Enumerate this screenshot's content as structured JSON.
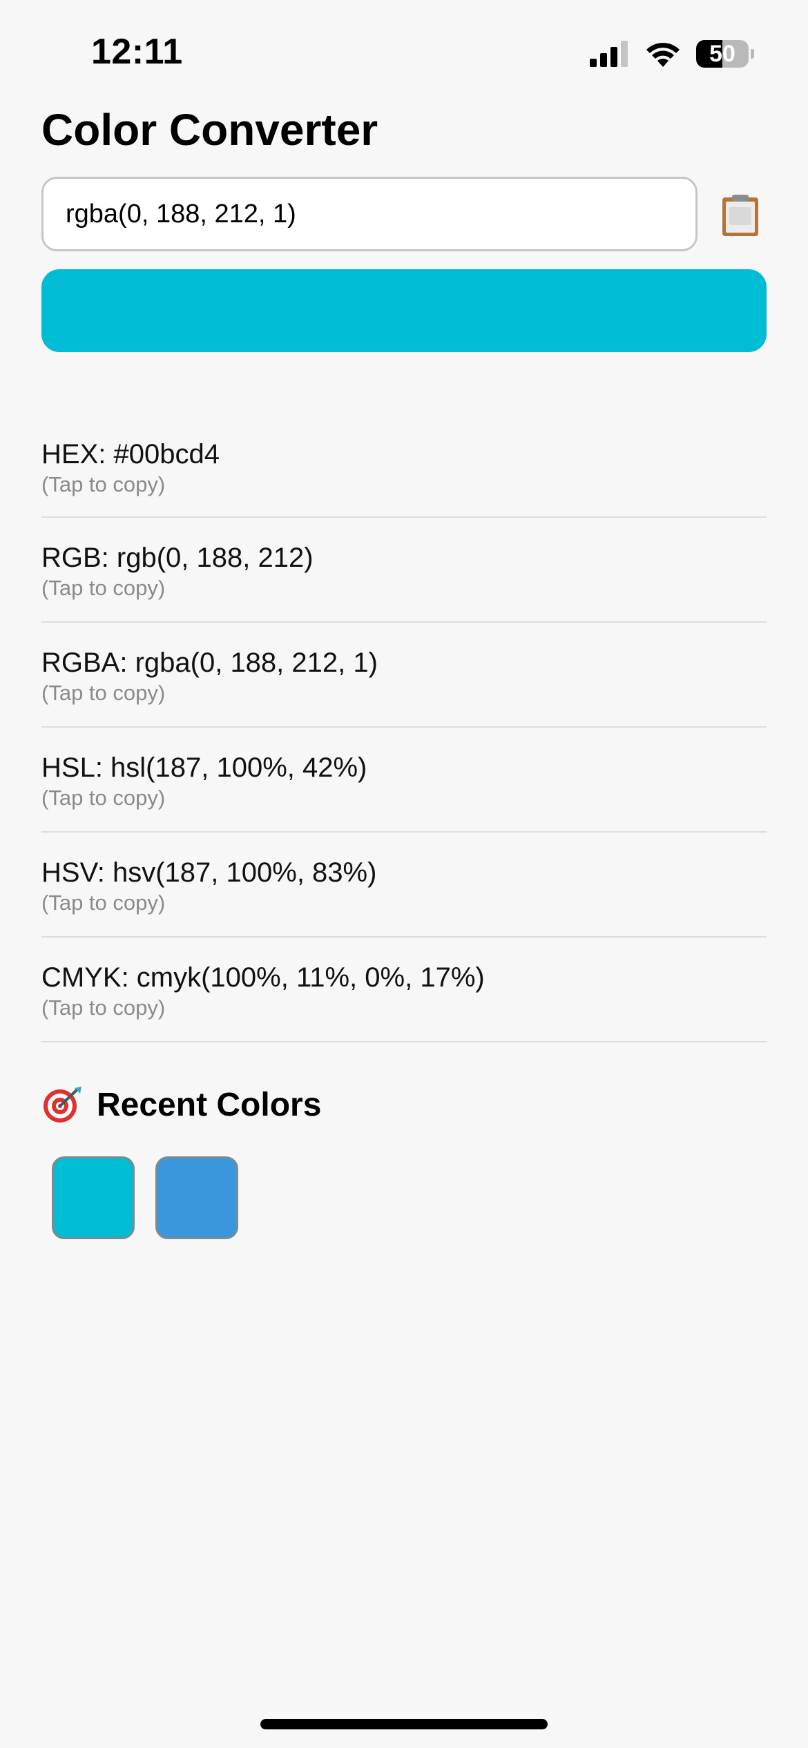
{
  "status_bar": {
    "time": "12:11",
    "battery_level": "50",
    "battery_fraction": 0.5
  },
  "page": {
    "title": "Color Converter"
  },
  "input": {
    "value": "rgba(0, 188, 212, 1)"
  },
  "preview": {
    "color": "#00bcd4"
  },
  "formats": [
    {
      "label": "HEX: #00bcd4",
      "hint": "(Tap to copy)"
    },
    {
      "label": "RGB: rgb(0, 188, 212)",
      "hint": "(Tap to copy)"
    },
    {
      "label": "RGBA: rgba(0, 188, 212, 1)",
      "hint": "(Tap to copy)"
    },
    {
      "label": "HSL: hsl(187, 100%, 42%)",
      "hint": "(Tap to copy)"
    },
    {
      "label": "HSV: hsv(187, 100%, 83%)",
      "hint": "(Tap to copy)"
    },
    {
      "label": "CMYK: cmyk(100%, 11%, 0%, 17%)",
      "hint": "(Tap to copy)"
    }
  ],
  "recent": {
    "title": "Recent Colors",
    "icon": "dart-target-icon",
    "swatches": [
      "#00bcd4",
      "#3a97db"
    ]
  }
}
